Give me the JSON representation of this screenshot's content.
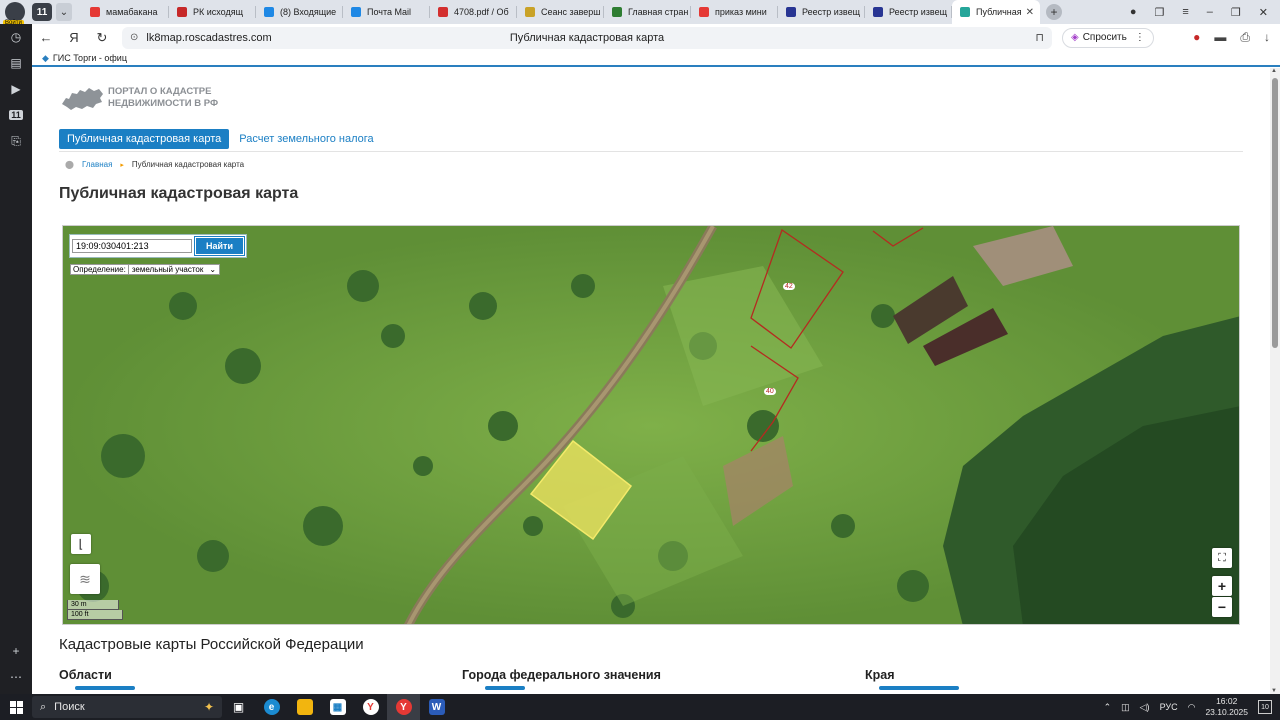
{
  "browser": {
    "tab_counter": "11",
    "profile_label": "Войти",
    "tabs": [
      {
        "label": "мамабакана",
        "color": "#e53935"
      },
      {
        "label": "РК исходящ",
        "color": "#c62828"
      },
      {
        "label": "(8) Входящие",
        "color": "#1e88e5"
      },
      {
        "label": "Почта Mail",
        "color": "#1e88e5"
      },
      {
        "label": "4708.pdf / Об",
        "color": "#d32f2f"
      },
      {
        "label": "Сеанс заверш",
        "color": "#c9a227"
      },
      {
        "label": "Главная стран",
        "color": "#2e7d32"
      },
      {
        "label": "приказ мини",
        "color": "#e53935"
      },
      {
        "label": "Реестр извещ",
        "color": "#283593"
      },
      {
        "label": "Реестр извещ",
        "color": "#283593"
      },
      {
        "label": "Публичная",
        "color": "#26a69a",
        "active": true
      }
    ],
    "url_host": "lk8map.roscadastres.com",
    "page_title": "Публичная кадастровая карта",
    "ask_label": "Спросить",
    "bookmark": "ГИС Торги - офиц"
  },
  "site": {
    "logo_line1": "ПОРТАЛ О КАДАСТРЕ",
    "logo_line2": "НЕДВИЖИМОСТИ В РФ",
    "menu_active": "Публичная кадастровая карта",
    "menu_tax": "Расчет земельного налога",
    "crumb_home": "Главная",
    "crumb_current": "Публичная кадастровая карта",
    "heading": "Публичная кадастровая карта"
  },
  "map": {
    "search_value": "19:09:030401:213",
    "search_button": "Найти",
    "definition_label": "Определение:",
    "definition_value": "земельный участок",
    "parcel_labels": [
      "42",
      "40"
    ],
    "scale_metric": "30 m",
    "scale_imperial": "100 ft",
    "zoom_in": "+",
    "zoom_out": "−"
  },
  "section": {
    "title": "Кадастровые карты Российской Федерации",
    "col1": "Области",
    "col2": "Города федерального значения",
    "col3": "Края"
  },
  "taskbar": {
    "search": "Поиск",
    "lang": "РУС",
    "time": "16:02",
    "date": "23.10.2025",
    "notif_count": "10"
  }
}
